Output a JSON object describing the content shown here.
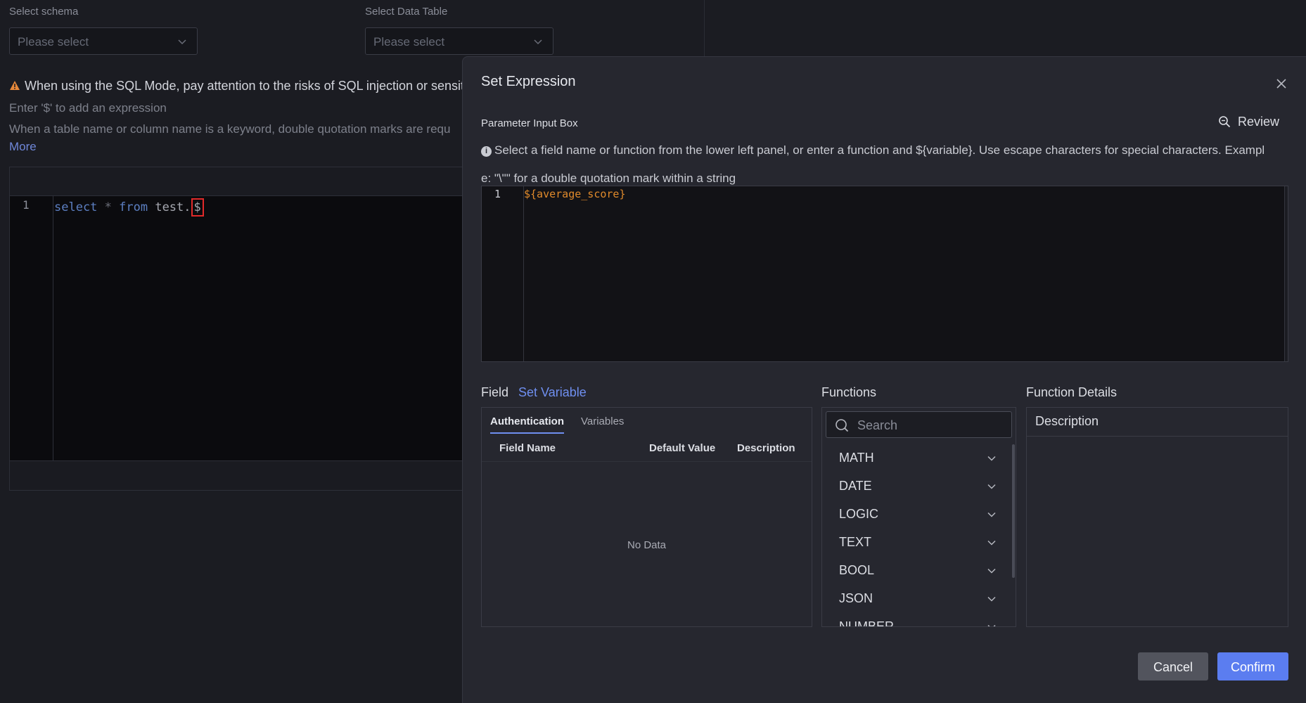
{
  "background": {
    "schema_label": "Select schema",
    "schema_placeholder": "Please select",
    "table_label": "Select Data Table",
    "table_placeholder": "Please select",
    "warning_text": "When using the SQL Mode, pay attention to the risks of SQL injection or sensitiv",
    "hint1": "Enter '$' to add an expression",
    "hint2": "When a table name or column name is a keyword, double quotation marks are requ",
    "more_link": "More",
    "editor": {
      "line_number": "1",
      "code_select": "select",
      "code_star": " * ",
      "code_from": "from",
      "code_table": " test.",
      "code_dollar": "$"
    }
  },
  "modal": {
    "title": "Set Expression",
    "param_label": "Parameter Input Box",
    "review_label": "Review",
    "info_line1": "Select a field name or function from the lower left panel, or enter a function and ${variable}. Use escape characters for special characters. Exampl",
    "info_line2": "e: \"\\\"\" for a double quotation mark within a string",
    "editor": {
      "line_number": "1",
      "code": "${average_score}"
    },
    "field_section": {
      "title": "Field",
      "set_variable": "Set Variable",
      "tabs": [
        "Authentication",
        "Variables"
      ],
      "columns": [
        "Field Name",
        "Default Value",
        "Description"
      ],
      "empty_text": "No Data"
    },
    "functions_section": {
      "title": "Functions",
      "search_placeholder": "Search",
      "items": [
        "MATH",
        "DATE",
        "LOGIC",
        "TEXT",
        "BOOL",
        "JSON",
        "NUMBER"
      ]
    },
    "details_section": {
      "title": "Function Details",
      "header": "Description"
    },
    "buttons": {
      "cancel": "Cancel",
      "confirm": "Confirm"
    }
  },
  "colors": {
    "accent": "#5b7df0",
    "code_orange": "#e08a2b",
    "highlight_red": "#e22a2a",
    "warning_orange": "#e6883a"
  }
}
